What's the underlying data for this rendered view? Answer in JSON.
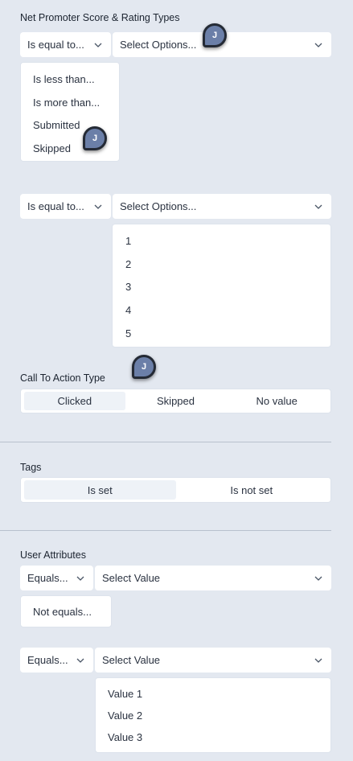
{
  "nps": {
    "title": "Net Promoter Score & Rating Types",
    "row1": {
      "operator": "Is equal to...",
      "placeholder": "Select Options..."
    },
    "operator_menu": [
      "Is less than...",
      "Is more than...",
      "Submitted",
      "Skipped"
    ],
    "row2": {
      "operator": "Is equal to...",
      "placeholder": "Select Options..."
    },
    "options_menu": [
      "1",
      "2",
      "3",
      "4",
      "5"
    ]
  },
  "cta": {
    "title": "Call To Action Type",
    "options": [
      "Clicked",
      "Skipped",
      "No value"
    ],
    "active": "Clicked"
  },
  "tags": {
    "title": "Tags",
    "options": [
      "Is set",
      "Is not set"
    ],
    "active": "Is set"
  },
  "user_attributes": {
    "title": "User Attributes",
    "row1": {
      "operator": "Equals...",
      "placeholder": "Select Value"
    },
    "operator_menu": [
      "Not equals..."
    ],
    "row2": {
      "operator": "Equals...",
      "placeholder": "Select Value"
    },
    "value_menu": [
      "Value 1",
      "Value 2",
      "Value 3"
    ]
  },
  "cursor": {
    "initial": "J"
  },
  "colors": {
    "background": "#e3e8f0",
    "surface": "#ffffff",
    "active_segment": "#eef2f7",
    "divider": "#b8c1cd",
    "avatar": "#6b7fa8"
  }
}
